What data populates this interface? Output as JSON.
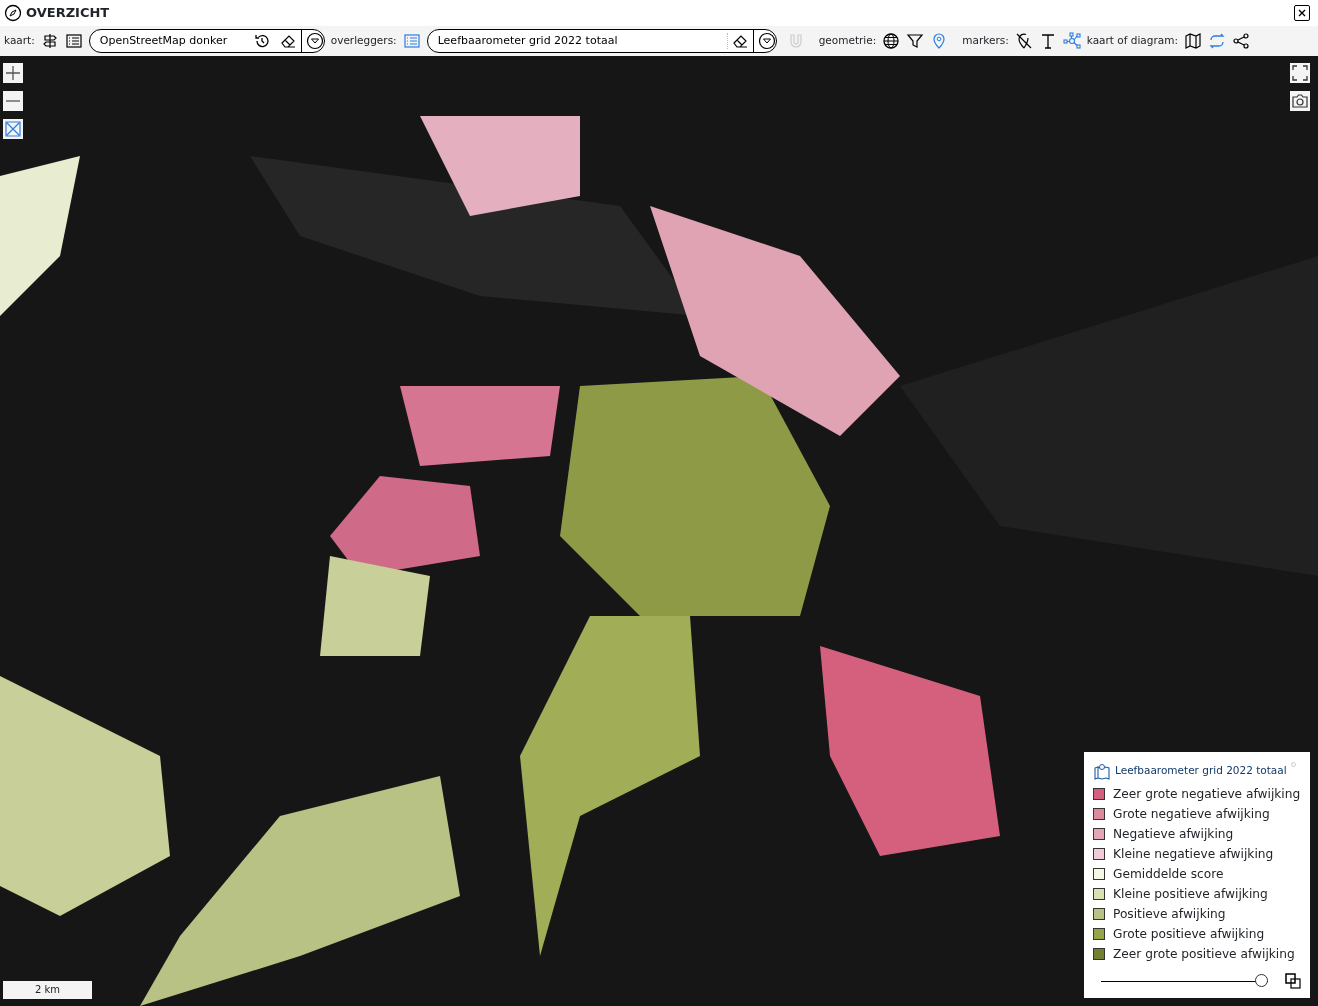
{
  "window": {
    "title": "OVERZICHT"
  },
  "toolbar": {
    "map_label": "kaart:",
    "map_field": {
      "value": "OpenStreetMap donker"
    },
    "overlay_label": "overleggers:",
    "overlay_field": {
      "value": "Leefbaarometer grid 2022 totaal"
    },
    "magnet_button": {
      "disabled": true
    },
    "geometry_label": "geometrie:",
    "markers_label": "markers:",
    "view_label": "kaart of diagram:"
  },
  "map": {
    "kind": "picture",
    "scale_bar": "2 km"
  },
  "legend": {
    "title": "Leefbaarometer grid 2022 totaal",
    "items": [
      {
        "label": "Zeer grote negatieve afwijking",
        "color": "#d4607e"
      },
      {
        "label": "Grote negatieve afwijking",
        "color": "#de8a9e"
      },
      {
        "label": "Negatieve afwijking",
        "color": "#e4a6b6"
      },
      {
        "label": "Kleine negatieve afwijking",
        "color": "#f2cad6"
      },
      {
        "label": "Gemiddelde score",
        "color": "#f5f8e4"
      },
      {
        "label": "Kleine positieve afwijking",
        "color": "#d8e0b4"
      },
      {
        "label": "Positieve afwijking",
        "color": "#b8c284"
      },
      {
        "label": "Grote positieve afwijking",
        "color": "#98a44a"
      },
      {
        "label": "Zeer grote positieve afwijking",
        "color": "#757f32"
      }
    ],
    "opacity": {
      "level": 1
    }
  }
}
